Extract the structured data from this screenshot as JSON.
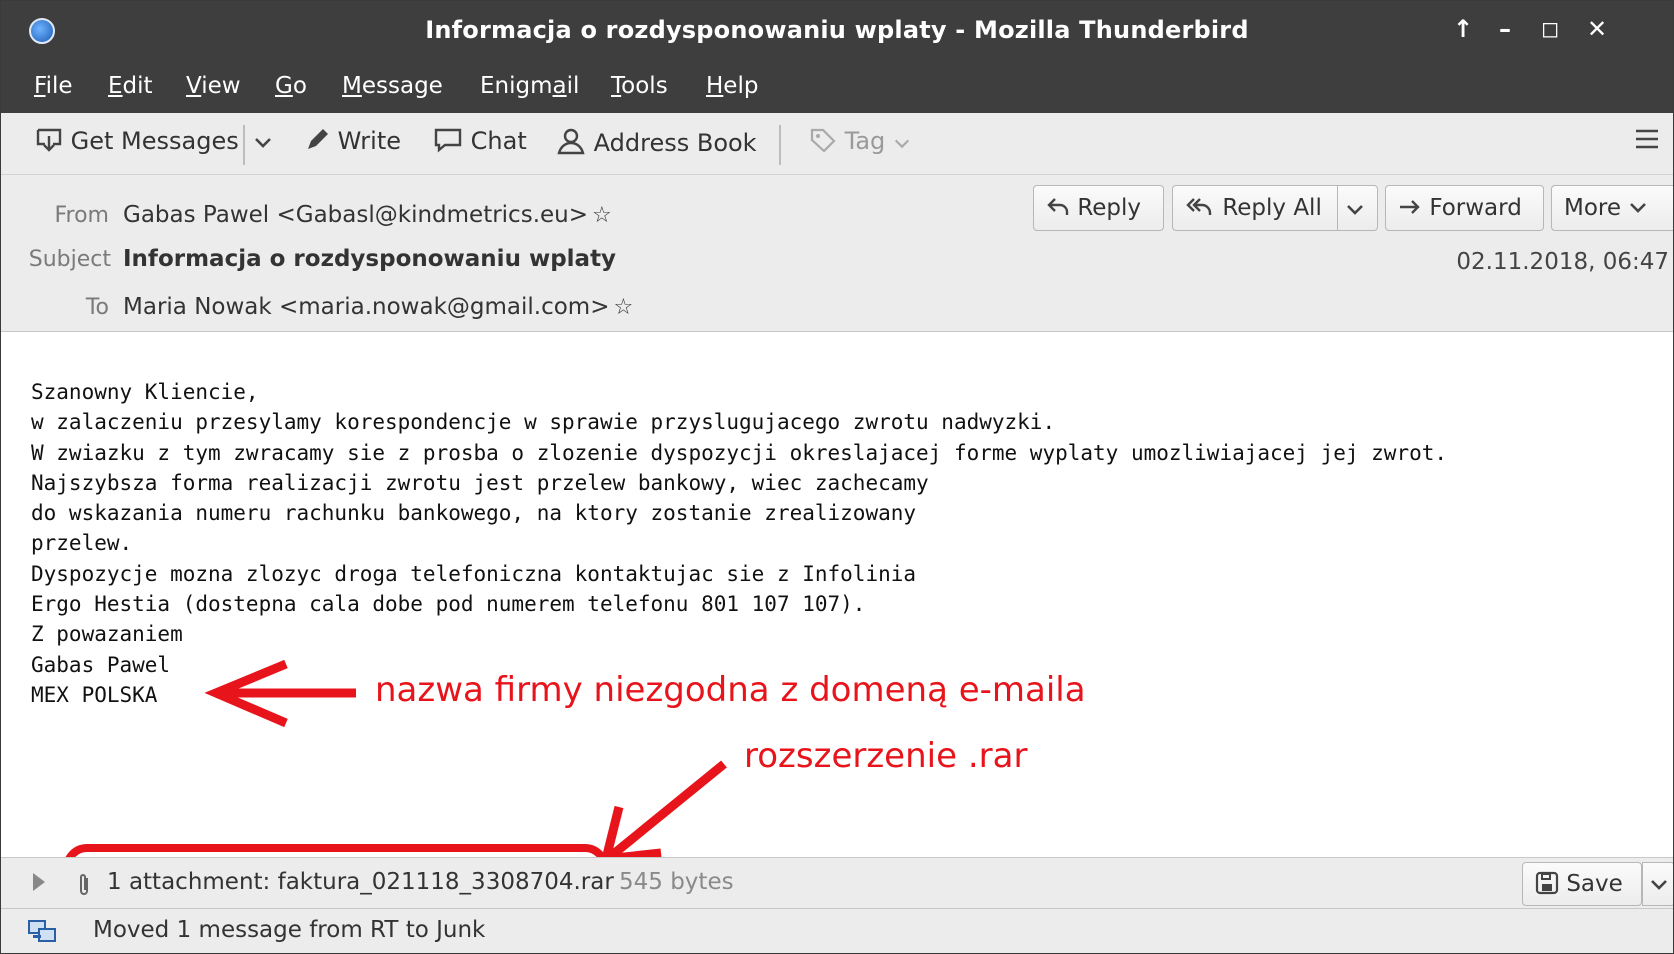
{
  "window": {
    "title": "Informacja o rozdysponowaniu wplaty - Mozilla Thunderbird",
    "controls": [
      "↑",
      "–",
      "◻",
      "✕"
    ]
  },
  "menu": [
    {
      "label": "File",
      "underline": "F",
      "rest": "ile"
    },
    {
      "label": "Edit",
      "underline": "E",
      "rest": "dit"
    },
    {
      "label": "View",
      "underline": "V",
      "rest": "iew"
    },
    {
      "label": "Go",
      "underline": "G",
      "rest": "o"
    },
    {
      "label": "Message",
      "underline": "M",
      "rest": "essage"
    },
    {
      "label": "Enigmail",
      "pre": "Enigm",
      "underline": "a",
      "rest": "il"
    },
    {
      "label": "Tools",
      "underline": "T",
      "rest": "ools"
    },
    {
      "label": "Help",
      "underline": "H",
      "rest": "elp"
    }
  ],
  "toolbar": {
    "get_messages": "Get Messages",
    "write": "Write",
    "chat": "Chat",
    "address_book": "Address Book",
    "tag": "Tag"
  },
  "header": {
    "from_label": "From",
    "from_value": "Gabas Pawel <Gabasl@kindmetrics.eu>",
    "subject_label": "Subject",
    "subject_value": "Informacja o rozdysponowaniu wplaty",
    "to_label": "To",
    "to_value": "Maria Nowak <maria.nowak@gmail.com>",
    "date": "02.11.2018, 06:47",
    "reply": "Reply",
    "reply_all": "Reply All",
    "forward": "Forward",
    "more": "More"
  },
  "body": {
    "text": "Szanowny Kliencie,\nw zalaczeniu przesylamy korespondencje w sprawie przyslugujacego zwrotu nadwyzki.\nW zwiazku z tym zwracamy sie z prosba o zlozenie dyspozycji okreslajacej forme wyplaty umozliwiajacej jej zwrot.\nNajszybsza forma realizacji zwrotu jest przelew bankowy, wiec zachecamy\ndo wskazania numeru rachunku bankowego, na ktory zostanie zrealizowany\nprzelew.\nDyspozycje mozna zlozyc droga telefoniczna kontaktujac sie z Infolinia\nErgo Hestia (dostepna cala dobe pod numerem telefonu 801 107 107).\nZ powazaniem\nGabas Pawel\nMEX POLSKA"
  },
  "annotations": {
    "company_note": "nazwa firmy niezgodna z domeną e-maila",
    "extension_note": "rozszerzenie .rar",
    "color": "#e8141b"
  },
  "attachment": {
    "summary": "1 attachment: faktura_021118_3308704.rar",
    "size": "545 bytes",
    "save": "Save"
  },
  "status": {
    "text": "Moved 1 message from RT to Junk"
  }
}
